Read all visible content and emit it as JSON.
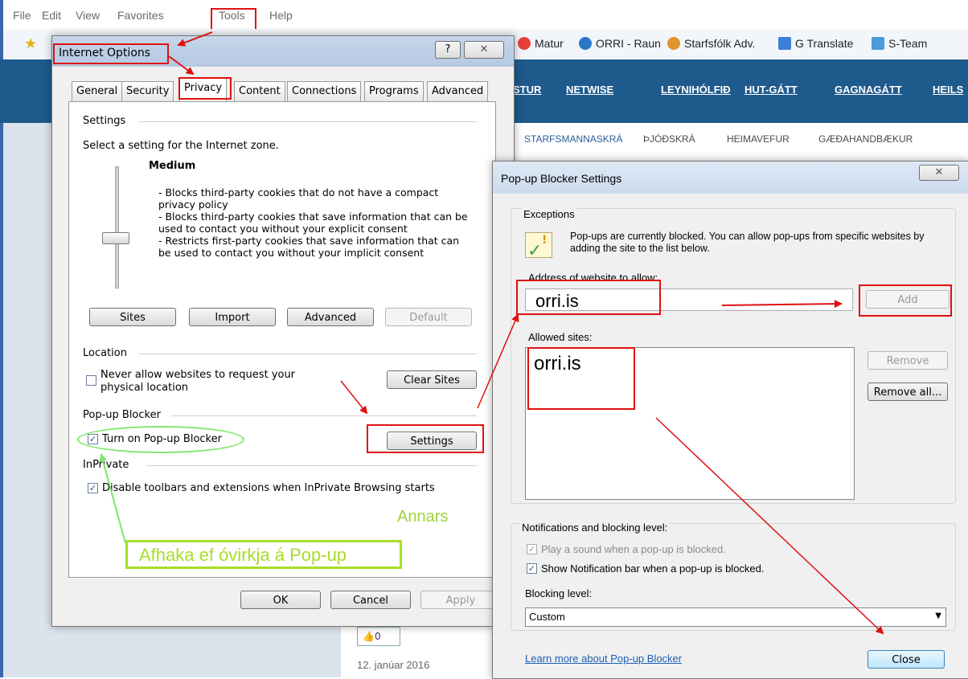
{
  "browser": {
    "menu": [
      "File",
      "Edit",
      "View",
      "Favorites",
      "Tools",
      "Help"
    ],
    "favorites": [
      {
        "label": "Matur",
        "color": "#e5403a"
      },
      {
        "label": "ORRI - Raun",
        "color": "#2c76c9"
      },
      {
        "label": "Starfsfólk Adv.",
        "color": "#e0952a"
      },
      {
        "label": "G Translate",
        "color": "#3b7fd6"
      },
      {
        "label": "S-Team",
        "color": "#4a9bd8"
      }
    ],
    "site_nav": [
      "STUR",
      "NETWISE",
      "LEYNIHÓLFIÐ",
      "HUT-GÁTT",
      "GAGNAGÁTT",
      "HEILS"
    ],
    "sub_nav": [
      "STARFSMANNASKRÁ",
      "ÞJÓÐSKRÁ",
      "HEIMAVEFUR",
      "GÆÐAHANDBÆKUR"
    ],
    "like_count": "0",
    "date_text": "12. janúar 2016"
  },
  "internet_options": {
    "title": "Internet Options",
    "help_glyph": "?",
    "tabs": [
      "General",
      "Security",
      "Privacy",
      "Content",
      "Connections",
      "Programs",
      "Advanced"
    ],
    "active_tab": "Privacy",
    "settings_heading": "Settings",
    "zone_text": "Select a setting for the Internet zone.",
    "level_name": "Medium",
    "level_description": "- Blocks third-party cookies that do not have a compact privacy policy\n- Blocks third-party cookies that save information that can be used to contact you without your explicit consent\n- Restricts first-party cookies that save information that can be used to contact you without your implicit consent",
    "buttons_row": [
      "Sites",
      "Import",
      "Advanced",
      "Default"
    ],
    "location_heading": "Location",
    "location_check": "Never allow websites to request your physical location",
    "clear_sites": "Clear Sites",
    "popup_heading": "Pop-up Blocker",
    "popup_check": "Turn on Pop-up Blocker",
    "popup_checked": true,
    "settings_button": "Settings",
    "inprivate_heading": "InPrivate",
    "inprivate_check": "Disable toolbars and extensions when InPrivate Browsing starts",
    "inprivate_checked": true,
    "ok": "OK",
    "cancel": "Cancel",
    "apply": "Apply"
  },
  "annotations": {
    "annars": "Annars",
    "afhaka": "Afhaka ef óvirkja á Pop-up",
    "red_color": "#e01010",
    "green_color": "#7ee86a",
    "lime_color": "#a8dd2a"
  },
  "popup_settings": {
    "title": "Pop-up Blocker Settings",
    "exceptions_heading": "Exceptions",
    "info_text": "Pop-ups are currently blocked.  You can allow pop-ups from specific websites by adding the site to the list below.",
    "address_label": "Address of website to allow:",
    "address_value": "orri.is",
    "add": "Add",
    "allowed_label": "Allowed sites:",
    "allowed_sites": [
      "orri.is"
    ],
    "remove": "Remove",
    "remove_all": "Remove all...",
    "notif_heading": "Notifications and blocking level:",
    "play_sound": "Play a sound when a pop-up is blocked.",
    "play_sound_checked": true,
    "show_bar": "Show Notification bar when a pop-up is blocked.",
    "show_bar_checked": true,
    "blocking_label": "Blocking level:",
    "blocking_value": "Custom",
    "learn_more": "Learn more about Pop-up Blocker",
    "close": "Close"
  }
}
